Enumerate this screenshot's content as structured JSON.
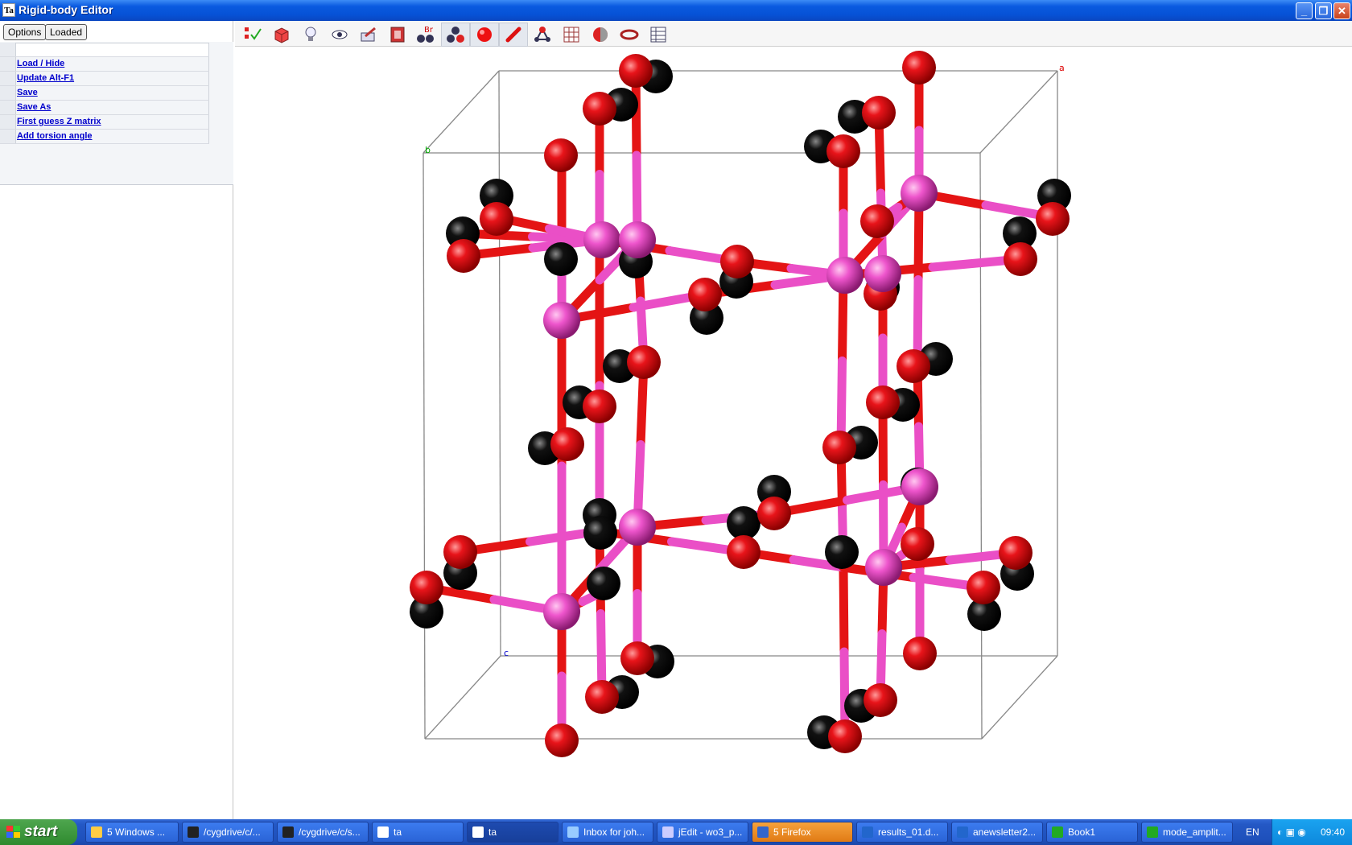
{
  "window": {
    "title": "Rigid-body Editor",
    "app_icon": "Ta"
  },
  "left_panel": {
    "options_label": "Options",
    "loaded_label": "Loaded",
    "menu_items": [
      "Load / Hide",
      "Update Alt-F1",
      "Save",
      "Save As",
      "First guess Z matrix",
      "Add torsion angle"
    ]
  },
  "toolbar": {
    "tools": [
      "select-check-icon",
      "box-icon",
      "light-bulb-icon",
      "eye-icon",
      "pen-tool-icon",
      "frame-icon",
      "bromine-atoms-icon",
      "ball-cluster-icon",
      "red-ball-icon",
      "bond-stick-icon",
      "molecule-icon",
      "grid-icon",
      "sphere-half-icon",
      "ring-icon",
      "table-icon"
    ]
  },
  "viewport": {
    "axis_labels": {
      "a": "a",
      "b": "b",
      "c": "c"
    },
    "colors": {
      "oxygen": "#e8141a",
      "metal": "#ee55cc",
      "dark_atom": "#111111",
      "cell_edge": "#888888"
    }
  },
  "taskbar": {
    "start_label": "start",
    "tasks": [
      "5 Windows ...",
      "/cygdrive/c/...",
      "/cygdrive/c/s...",
      "ta",
      "ta",
      "Inbox for joh...",
      "jEdit - wo3_p...",
      "5 Firefox",
      "results_01.d...",
      "anewsletter2...",
      "Book1",
      "mode_amplit..."
    ],
    "language": "EN",
    "clock": "09:40"
  }
}
